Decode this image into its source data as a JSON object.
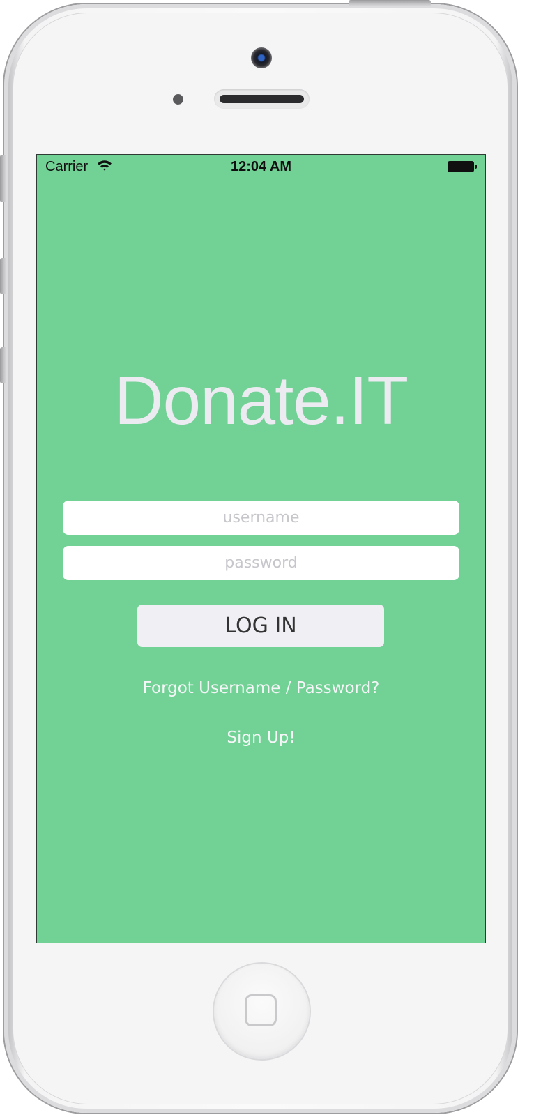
{
  "status_bar": {
    "carrier": "Carrier",
    "time": "12:04 AM"
  },
  "app": {
    "title": "Donate.IT",
    "background_color": "#72d296"
  },
  "login_form": {
    "username_placeholder": "username",
    "username_value": "",
    "password_placeholder": "password",
    "password_value": "",
    "login_label": "LOG IN"
  },
  "links": {
    "forgot": "Forgot Username / Password?",
    "signup": "Sign Up!"
  },
  "icons": [
    "wifi-icon",
    "battery-icon",
    "front-camera-icon",
    "home-button-icon"
  ]
}
